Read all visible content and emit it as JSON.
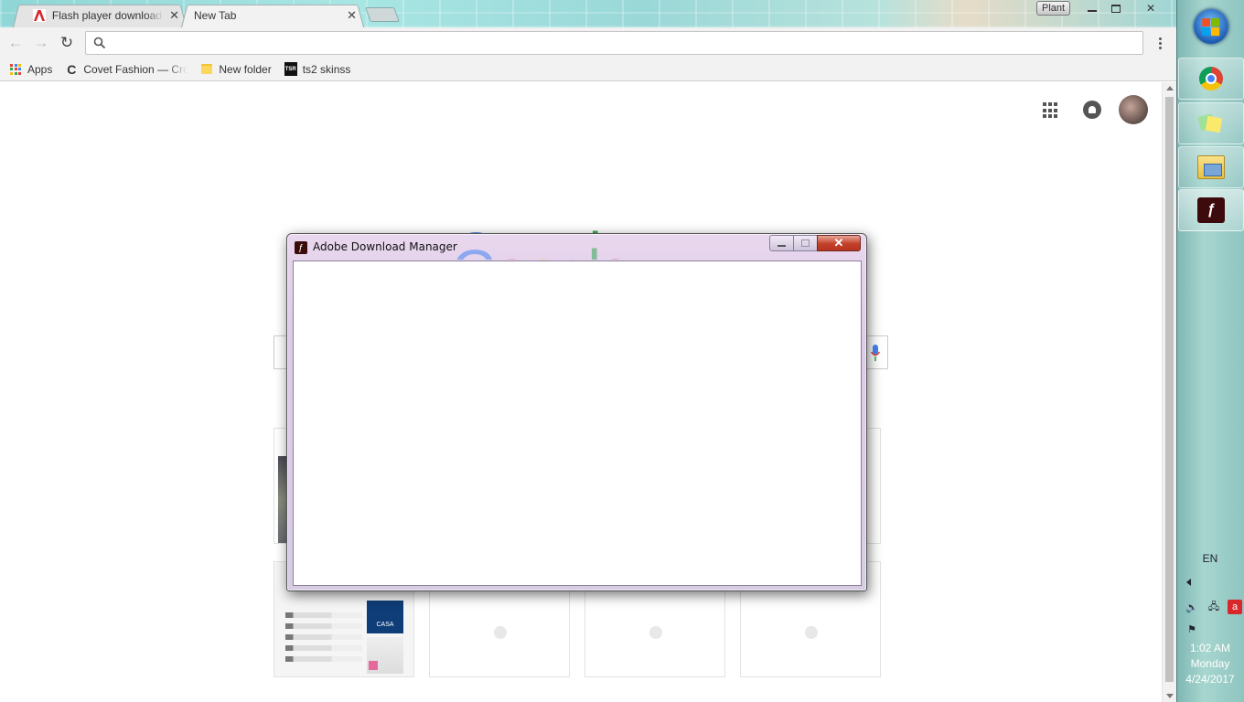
{
  "browser": {
    "tabs": [
      {
        "title": "Flash player download: d",
        "favicon": "adobe-icon",
        "active": false
      },
      {
        "title": "New Tab",
        "favicon": "",
        "active": true
      }
    ],
    "profile_badge": "Plant",
    "omnibox": {
      "value": "",
      "placeholder": ""
    },
    "bookmarks": [
      {
        "label": "Apps",
        "icon": "apps-grid-icon"
      },
      {
        "label": "Covet Fashion — Crow",
        "icon": "covet-icon"
      },
      {
        "label": "New folder",
        "icon": "folder-icon"
      },
      {
        "label": "ts2 skinss",
        "icon": "tsr-icon"
      }
    ]
  },
  "newtab": {
    "logo_text": "Google",
    "tile_casa_label": "CASA"
  },
  "dialog": {
    "title": "Adobe Download Manager",
    "close_glyph": "✕"
  },
  "taskbar": {
    "apps": [
      "chrome-icon",
      "sticky-notes-icon",
      "file-explorer-icon",
      "adobe-flash-icon"
    ],
    "language": "EN",
    "clock": {
      "time": "1:02 AM",
      "day": "Monday",
      "date": "4/24/2017"
    }
  },
  "colors": {
    "adobe_red": "#3a0b0b",
    "close_button": "#c2402a",
    "taskbar_teal": "#a7d6cf"
  }
}
